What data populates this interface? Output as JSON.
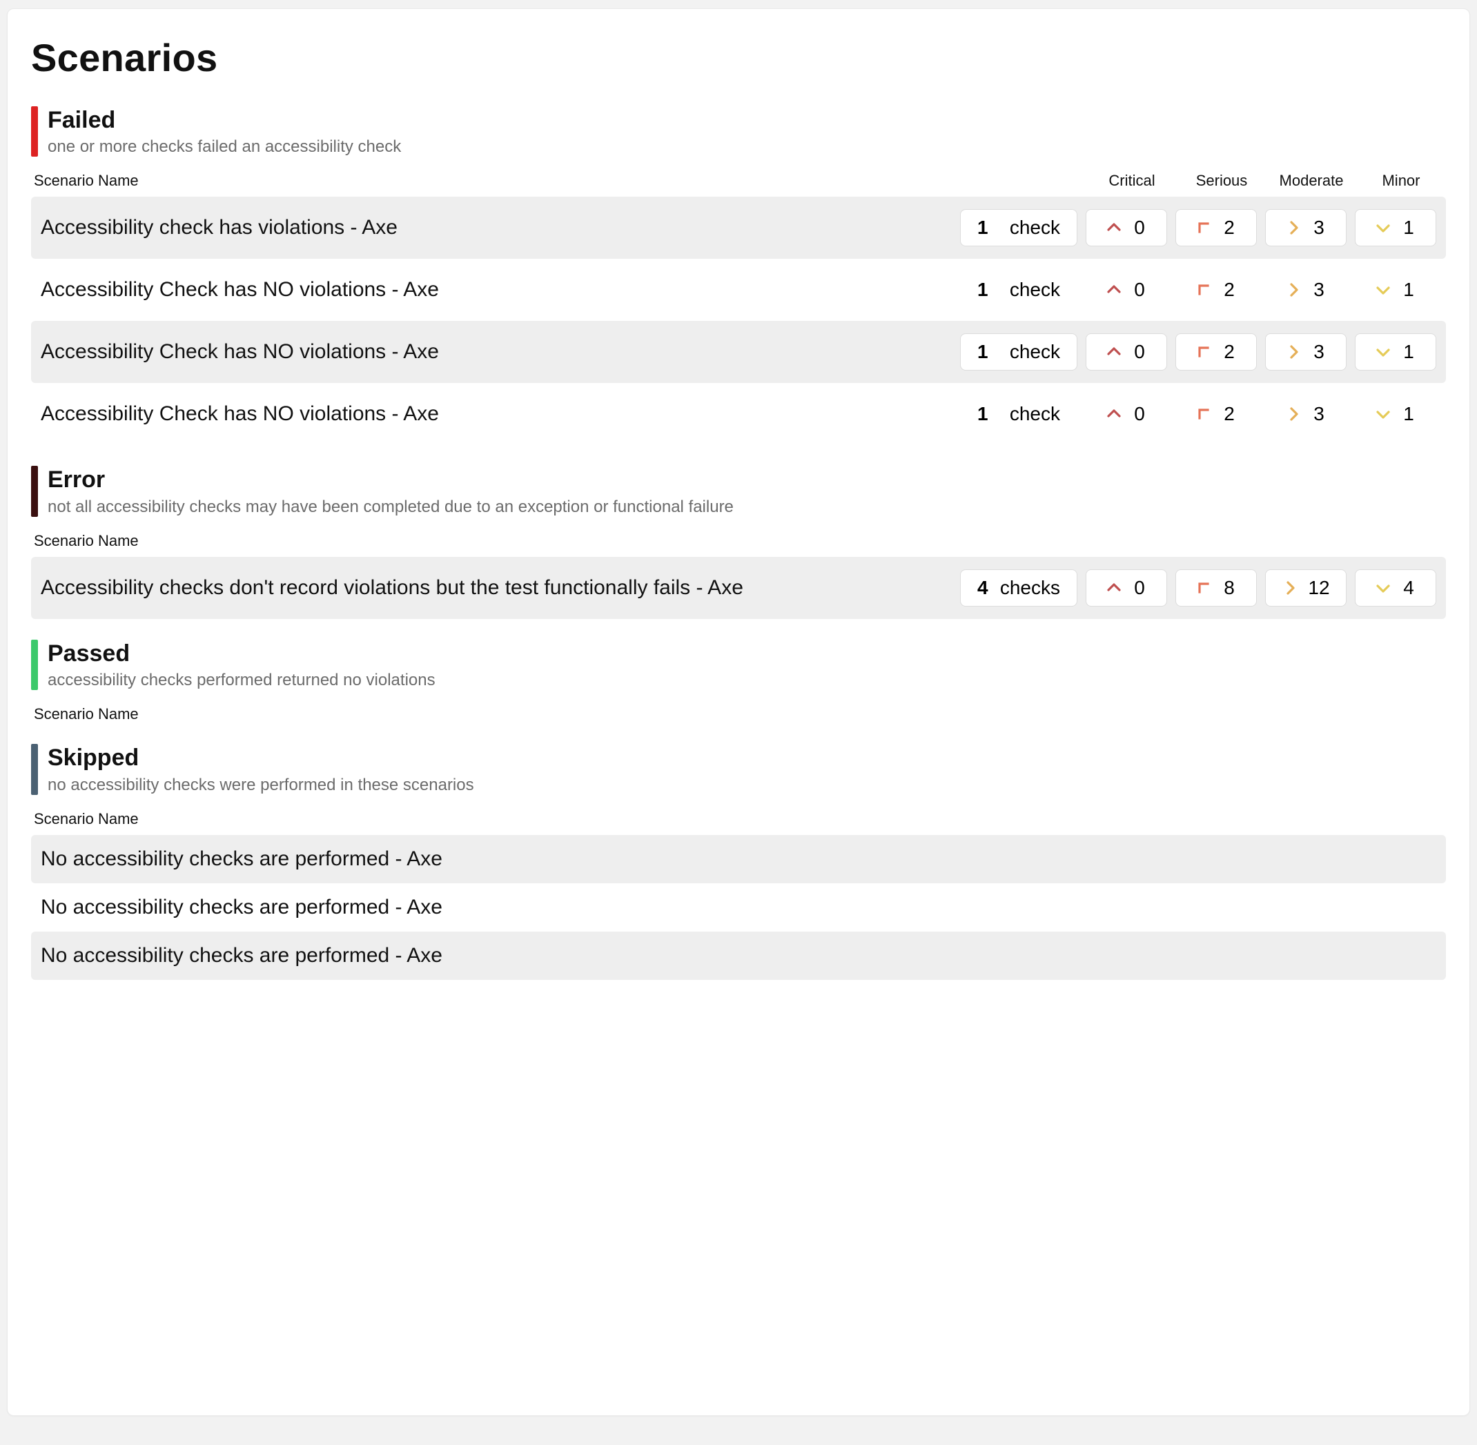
{
  "page_title": "Scenarios",
  "column_headers": {
    "scenario": "Scenario Name",
    "severities": [
      "Critical",
      "Serious",
      "Moderate",
      "Minor"
    ]
  },
  "sections": [
    {
      "id": "failed",
      "title": "Failed",
      "subtitle": "one or more checks failed an accessibility check",
      "accent": "failed",
      "show_severity_headers": true,
      "rows": [
        {
          "name": "Accessibility check has violations - Axe",
          "checks_count": 1,
          "checks_label": "check",
          "critical": 0,
          "serious": 2,
          "moderate": 3,
          "minor": 1
        },
        {
          "name": "Accessibility Check has NO violations - Axe",
          "checks_count": 1,
          "checks_label": "check",
          "critical": 0,
          "serious": 2,
          "moderate": 3,
          "minor": 1
        },
        {
          "name": "Accessibility Check has NO violations - Axe",
          "checks_count": 1,
          "checks_label": "check",
          "critical": 0,
          "serious": 2,
          "moderate": 3,
          "minor": 1
        },
        {
          "name": "Accessibility Check has NO violations - Axe",
          "checks_count": 1,
          "checks_label": "check",
          "critical": 0,
          "serious": 2,
          "moderate": 3,
          "minor": 1
        }
      ]
    },
    {
      "id": "error",
      "title": "Error",
      "subtitle": "not all accessibility checks may have been completed due to an exception or functional failure",
      "accent": "error",
      "show_severity_headers": false,
      "rows": [
        {
          "name": "Accessibility checks don't record violations but the test functionally fails - Axe",
          "checks_count": 4,
          "checks_label": "checks",
          "critical": 0,
          "serious": 8,
          "moderate": 12,
          "minor": 4
        }
      ]
    },
    {
      "id": "passed",
      "title": "Passed",
      "subtitle": "accessibility checks performed returned no violations",
      "accent": "passed",
      "show_severity_headers": false,
      "rows": []
    },
    {
      "id": "skipped",
      "title": "Skipped",
      "subtitle": "no accessibility checks were performed in these scenarios",
      "accent": "skipped",
      "show_severity_headers": false,
      "rows": [
        {
          "name": "No accessibility checks are performed - Axe"
        },
        {
          "name": "No accessibility checks are performed - Axe"
        },
        {
          "name": "No accessibility checks are performed - Axe"
        }
      ]
    }
  ]
}
